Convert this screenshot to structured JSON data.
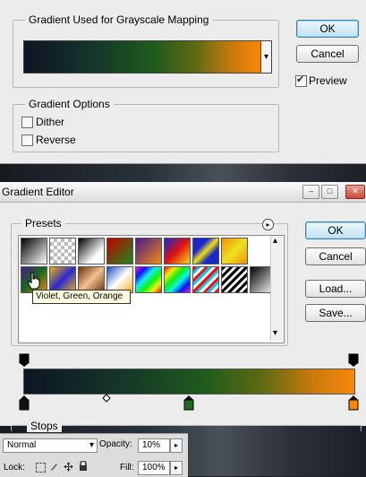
{
  "gradient_map": {
    "gradient_group_label": "Gradient Used for Grayscale Mapping",
    "options_group_label": "Gradient Options",
    "dither_label": "Dither",
    "reverse_label": "Reverse",
    "dropdown_arrow": "▾",
    "ok_label": "OK",
    "cancel_label": "Cancel",
    "preview_label": "Preview",
    "dither_checked": false,
    "reverse_checked": false,
    "preview_checked": true
  },
  "gradient_editor": {
    "title": "Gradient Editor",
    "minimize_glyph": "–",
    "maximize_glyph": "□",
    "close_glyph": "✕",
    "presets_label": "Presets",
    "presets_menu_glyph": "▸",
    "ok_label": "OK",
    "cancel_label": "Cancel",
    "load_label": "Load...",
    "save_label": "Save...",
    "tooltip": "Violet, Green, Orange",
    "stops_label": "Stops",
    "scroll_up": "▴",
    "scroll_down": "▾",
    "colors": {
      "gradient_start": "#0e1524",
      "gradient_mid": "#1f5b1d",
      "gradient_end": "#f8880a",
      "default_button": "#bfe3f6"
    }
  },
  "layers_panel": {
    "blend_mode": "Normal",
    "opacity_label": "Opacity:",
    "opacity_value": "10%",
    "lock_label": "Lock:",
    "fill_label": "Fill:",
    "fill_value": "100%",
    "stepper_glyph": "▸",
    "blend_arrow": "▾"
  }
}
